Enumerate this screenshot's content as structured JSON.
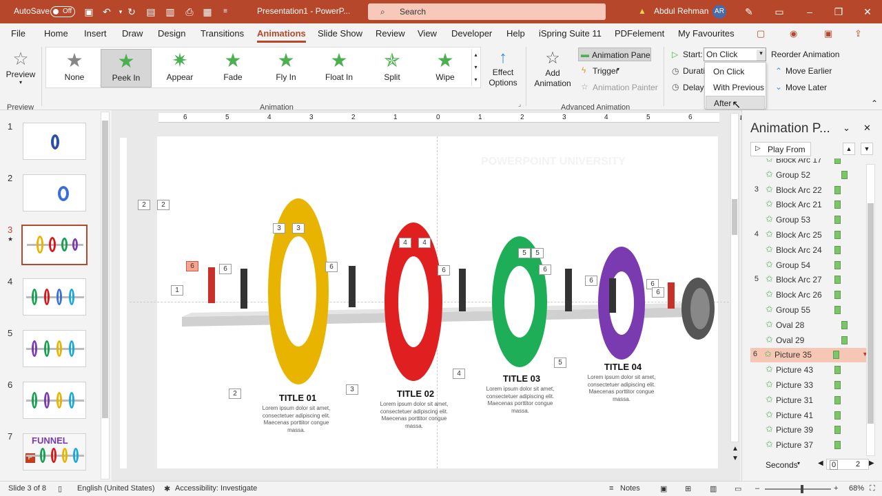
{
  "titlebar": {
    "autosave_label": "AutoSave",
    "autosave_state": "Off",
    "doc_title": "Presentation1 - PowerP...",
    "search_placeholder": "Search",
    "user_name": "Abdul Rehman",
    "user_initials": "AR",
    "accent": "#b7472a"
  },
  "menu": [
    "File",
    "Home",
    "Insert",
    "Draw",
    "Design",
    "Transitions",
    "Animations",
    "Slide Show",
    "Review",
    "View",
    "Developer",
    "Help",
    "iSpring Suite 11",
    "PDFelement",
    "My Favourites"
  ],
  "ribbon": {
    "preview_label": "Preview",
    "preview_group": "Preview",
    "effects": [
      "None",
      "Peek In",
      "Appear",
      "Fade",
      "Fly In",
      "Float In",
      "Split",
      "Wipe"
    ],
    "selected_effect": "Peek In",
    "effect_options": "Effect Options",
    "animation_group": "Animation",
    "add_animation": "Add Animation",
    "animation_pane": "Animation Pane",
    "trigger": "Trigger",
    "animation_painter": "Animation Painter",
    "advanced_group": "Advanced Animation",
    "start_label": "Start:",
    "start_value": "On Click",
    "duration_label": "Durati",
    "delay_label": "Delay:",
    "reorder": "Reorder Animation",
    "move_earlier": "Move Earlier",
    "move_later": "Move Later"
  },
  "dropdown": {
    "options": [
      "On Click",
      "With Previous",
      "After Previous"
    ],
    "hovered": "After Previous"
  },
  "thumbnails": [
    "1",
    "2",
    "3",
    "4",
    "5",
    "6",
    "7"
  ],
  "current_slide_marker": "★",
  "thumb7_text": "FUNNEL",
  "slide": {
    "watermark": "POWERPOINT UNIVERSITY",
    "titles": [
      "TITLE 01",
      "TITLE 02",
      "TITLE 03",
      "TITLE 04"
    ],
    "body": "Lorem ipsum dolor sit amet, consectetuer adipiscing elit. Maecenas porttitor congue massa.",
    "ruler_numbers": [
      "6",
      "5",
      "4",
      "3",
      "2",
      "1",
      "0",
      "1",
      "2",
      "3",
      "4",
      "5",
      "6"
    ],
    "tags": [
      "2",
      "2",
      "3",
      "3",
      "6",
      "6",
      "6",
      "6",
      "1",
      "4",
      "4",
      "6",
      "5",
      "5",
      "6",
      "6",
      "6",
      "5",
      "2",
      "3",
      "4",
      "5"
    ]
  },
  "pane": {
    "title": "Animation P...",
    "play_from": "Play From",
    "items": [
      {
        "n": "",
        "label": "Block Arc 17",
        "bar": 0
      },
      {
        "n": "",
        "label": "Group 52",
        "bar": 1
      },
      {
        "n": "3",
        "label": "Block Arc 22",
        "bar": 0
      },
      {
        "n": "",
        "label": "Block Arc 21",
        "bar": 0
      },
      {
        "n": "",
        "label": "Group 53",
        "bar": 0
      },
      {
        "n": "4",
        "label": "Block Arc 25",
        "bar": 0
      },
      {
        "n": "",
        "label": "Block Arc 24",
        "bar": 0
      },
      {
        "n": "",
        "label": "Group 54",
        "bar": 0
      },
      {
        "n": "5",
        "label": "Block Arc 27",
        "bar": 0
      },
      {
        "n": "",
        "label": "Block Arc 26",
        "bar": 0
      },
      {
        "n": "",
        "label": "Group 55",
        "bar": 0
      },
      {
        "n": "",
        "label": "Oval 28",
        "bar": 1
      },
      {
        "n": "",
        "label": "Oval 29",
        "bar": 1
      },
      {
        "n": "6",
        "label": "Picture 35",
        "bar": 0
      },
      {
        "n": "",
        "label": "Picture 43",
        "bar": 0
      },
      {
        "n": "",
        "label": "Picture 33",
        "bar": 0
      },
      {
        "n": "",
        "label": "Picture 31",
        "bar": 0
      },
      {
        "n": "",
        "label": "Picture 41",
        "bar": 0
      },
      {
        "n": "",
        "label": "Picture 39",
        "bar": 0
      },
      {
        "n": "",
        "label": "Picture 37",
        "bar": 0
      }
    ],
    "selected": "Picture 35",
    "seconds": "Seconds",
    "timeline_start": "0",
    "timeline_end": "2"
  },
  "status": {
    "slide_info": "Slide 3 of 8",
    "language": "English (United States)",
    "accessibility": "Accessibility: Investigate",
    "notes": "Notes",
    "zoom": "68%"
  }
}
